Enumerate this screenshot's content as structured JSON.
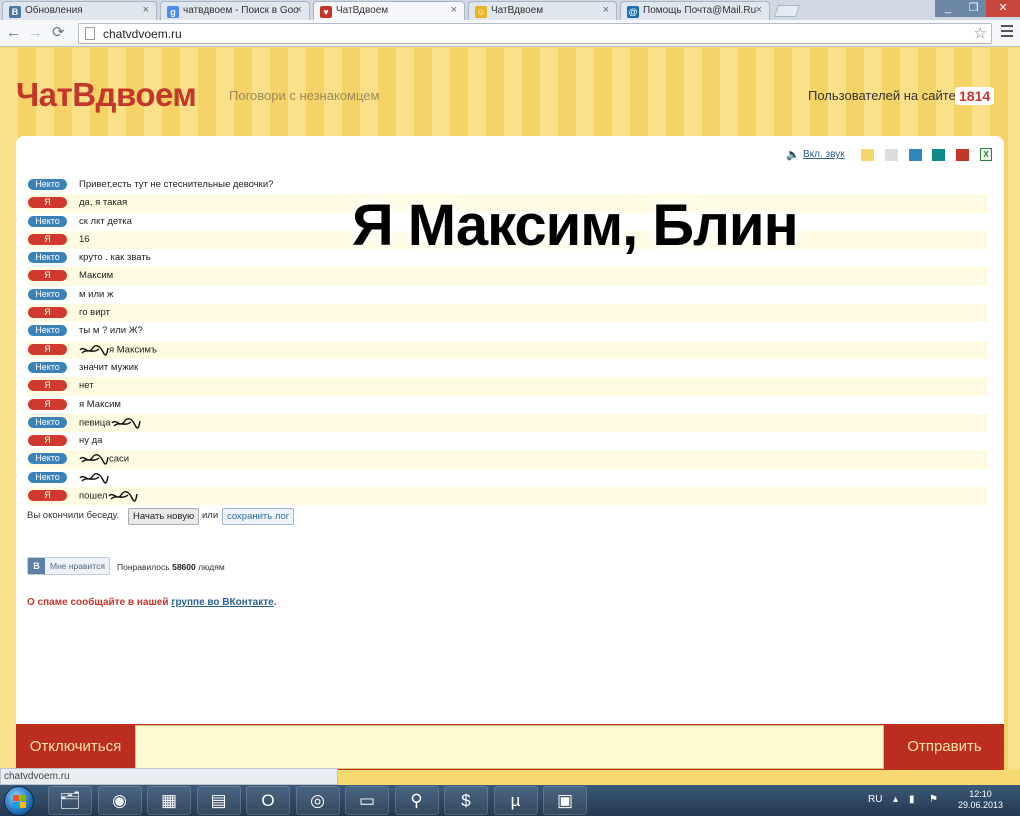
{
  "browser": {
    "tabs": [
      {
        "title": "Обновления",
        "favicon": "vk-icon",
        "color": "#4a76a8",
        "glyph": "В"
      },
      {
        "title": "чатвдвоем - Поиск в Goo",
        "favicon": "google-icon",
        "color": "#4a8af4",
        "glyph": "g"
      },
      {
        "title": "ЧатВдвоем",
        "favicon": "chatvdvoem-icon",
        "color": "#c5362a",
        "glyph": "♥"
      },
      {
        "title": "ЧатВдвоем",
        "favicon": "smiley-icon",
        "color": "#e8b520",
        "glyph": "☺"
      },
      {
        "title": "Помощь Почта@Mail.Ru",
        "favicon": "mailru-icon",
        "color": "#1a6fb5",
        "glyph": "@"
      }
    ],
    "url": "chatvdvoem.ru",
    "status_text": "chatvdvoem.ru"
  },
  "site": {
    "logo": "ЧатВдвоем",
    "tagline": "Поговори с незнакомцем",
    "users_label": "Пользователей на сайте",
    "users_count": "1814",
    "sound_link": "Вкл. звук",
    "theme_colors": [
      "#f5d76e",
      "#dddddd",
      "#2f86b8",
      "#138a8a",
      "#c5362a"
    ],
    "roles": {
      "stranger": "Некто",
      "me": "Я"
    },
    "messages": [
      {
        "role": "stranger",
        "text": "Привет,есть тут не стеснительные девочки?"
      },
      {
        "role": "me",
        "text": "да, я такая"
      },
      {
        "role": "stranger",
        "text": "ск лкт детка"
      },
      {
        "role": "me",
        "text": "16"
      },
      {
        "role": "stranger",
        "text": "круто . как звать"
      },
      {
        "role": "me",
        "text": "Максим"
      },
      {
        "role": "stranger",
        "text": "м или ж"
      },
      {
        "role": "me",
        "text": "го вирт"
      },
      {
        "role": "stranger",
        "text": "ты м ? или Ж?"
      },
      {
        "role": "me",
        "text": "я Максимъ",
        "prefix_scribble": true
      },
      {
        "role": "stranger",
        "text": "значит мужик"
      },
      {
        "role": "me",
        "text": "нет"
      },
      {
        "role": "me",
        "text": "я Максим"
      },
      {
        "role": "stranger",
        "text": "певица",
        "suffix_scribble": true
      },
      {
        "role": "me",
        "text": "ну да"
      },
      {
        "role": "stranger",
        "text": "саси",
        "prefix_scribble": true
      },
      {
        "role": "stranger",
        "text": "",
        "prefix_scribble": true
      },
      {
        "role": "me",
        "text": "пошел",
        "suffix_scribble": true
      }
    ],
    "ended_text": "Вы окончили беседу.",
    "new_chat_button": "Начать новую",
    "or_text": "или",
    "save_log_button": "сохранить лог",
    "vk_logo": "В",
    "like_button": "Мне нравится",
    "liked_prefix": "Понравилось",
    "liked_count": "58600",
    "liked_suffix": "людям",
    "spam_text": "О спаме сообщайте в нашей",
    "spam_link": "группе во ВКонтакте",
    "spam_dot": ".",
    "disconnect_button": "Отключиться",
    "send_button": "Отправить",
    "caption": "Я Максим, Блин"
  },
  "taskbar": {
    "pinned": [
      {
        "name": "explorer-icon",
        "glyph": "🗂"
      },
      {
        "name": "chrome-icon",
        "glyph": "◉"
      },
      {
        "name": "cube-icon",
        "glyph": "▦"
      },
      {
        "name": "calculator-icon",
        "glyph": "▤"
      },
      {
        "name": "opera-icon",
        "glyph": "O"
      },
      {
        "name": "radio-icon",
        "glyph": "◎"
      },
      {
        "name": "printer-icon",
        "glyph": "▭"
      },
      {
        "name": "magnifier-icon",
        "glyph": "⚲"
      },
      {
        "name": "money-icon",
        "glyph": "$"
      },
      {
        "name": "utorrent-icon",
        "glyph": "µ"
      },
      {
        "name": "game-icon",
        "glyph": "▣"
      }
    ],
    "language": "RU",
    "time": "12:10",
    "date": "29.06.2013"
  }
}
